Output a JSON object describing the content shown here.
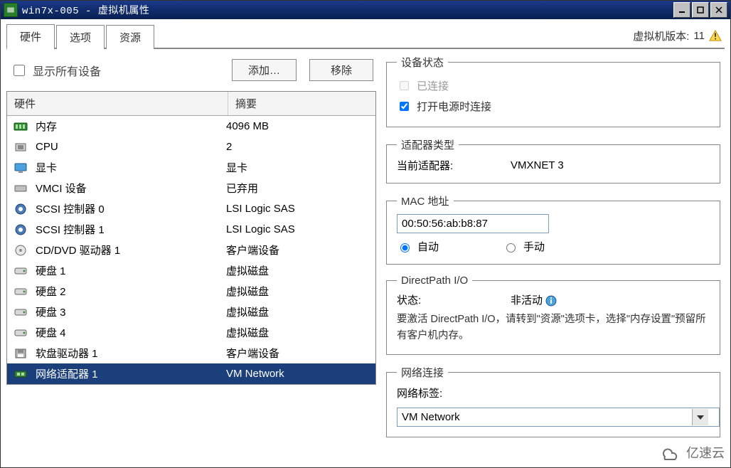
{
  "window": {
    "title": "win7x-005 - 虚拟机属性"
  },
  "tabs": {
    "hardware": "硬件",
    "options": "选项",
    "resources": "资源"
  },
  "version": {
    "label": "虚拟机版本:",
    "value": "11"
  },
  "top": {
    "show_all": "显示所有设备",
    "add": "添加…",
    "remove": "移除"
  },
  "listHeaders": {
    "name": "硬件",
    "summary": "摘要"
  },
  "hardware": [
    {
      "icon": "memory",
      "name": "内存",
      "summary": "4096 MB"
    },
    {
      "icon": "cpu",
      "name": "CPU",
      "summary": "2"
    },
    {
      "icon": "display",
      "name": "显卡",
      "summary": "显卡"
    },
    {
      "icon": "vmci",
      "name": "VMCI 设备",
      "summary": "已弃用"
    },
    {
      "icon": "scsi",
      "name": "SCSI 控制器 0",
      "summary": "LSI Logic SAS"
    },
    {
      "icon": "scsi",
      "name": "SCSI 控制器 1",
      "summary": "LSI Logic SAS"
    },
    {
      "icon": "cddvd",
      "name": "CD/DVD 驱动器 1",
      "summary": "客户端设备"
    },
    {
      "icon": "disk",
      "name": "硬盘 1",
      "summary": "虚拟磁盘"
    },
    {
      "icon": "disk",
      "name": "硬盘 2",
      "summary": "虚拟磁盘"
    },
    {
      "icon": "disk",
      "name": "硬盘 3",
      "summary": "虚拟磁盘"
    },
    {
      "icon": "disk",
      "name": "硬盘 4",
      "summary": "虚拟磁盘"
    },
    {
      "icon": "floppy",
      "name": "软盘驱动器 1",
      "summary": "客户端设备"
    },
    {
      "icon": "nic",
      "name": "网络适配器 1",
      "summary": "VM Network",
      "selected": true
    }
  ],
  "deviceStatus": {
    "legend": "设备状态",
    "connected": "已连接",
    "connect_on_power": "打开电源时连接"
  },
  "adapterType": {
    "legend": "适配器类型",
    "label": "当前适配器:",
    "value": "VMXNET 3"
  },
  "mac": {
    "legend": "MAC 地址",
    "value": "00:50:56:ab:b8:87",
    "auto": "自动",
    "manual": "手动"
  },
  "directpath": {
    "legend": "DirectPath I/O",
    "status_label": "状态:",
    "status_value": "非活动",
    "note": "要激活 DirectPath I/O，请转到\"资源\"选项卡，选择\"内存设置\"预留所有客户机内存。"
  },
  "netconn": {
    "legend": "网络连接",
    "label": "网络标签:",
    "value": "VM Network"
  },
  "watermark": "亿速云"
}
